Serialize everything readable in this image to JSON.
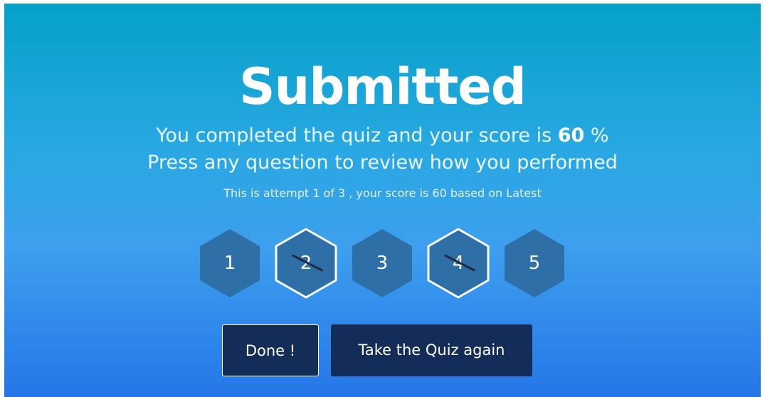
{
  "result": {
    "title": "Submitted",
    "score_prefix": "You completed the quiz and your score is ",
    "score_value": "60",
    "score_suffix": " %",
    "review_hint": "Press any question to review how you performed",
    "attempt_info": "This is attempt 1 of 3 , your score is 60 based on Latest"
  },
  "questions": [
    {
      "label": "1",
      "status": "correct"
    },
    {
      "label": "2",
      "status": "incorrect"
    },
    {
      "label": "3",
      "status": "correct"
    },
    {
      "label": "4",
      "status": "incorrect"
    },
    {
      "label": "5",
      "status": "correct"
    }
  ],
  "buttons": {
    "done_label": "Done !",
    "retake_label": "Take the Quiz again"
  },
  "colors": {
    "hex_fill": "#2d6fa6",
    "hex_incorrect_border": "#ffffff",
    "button_bg": "#132d58"
  }
}
